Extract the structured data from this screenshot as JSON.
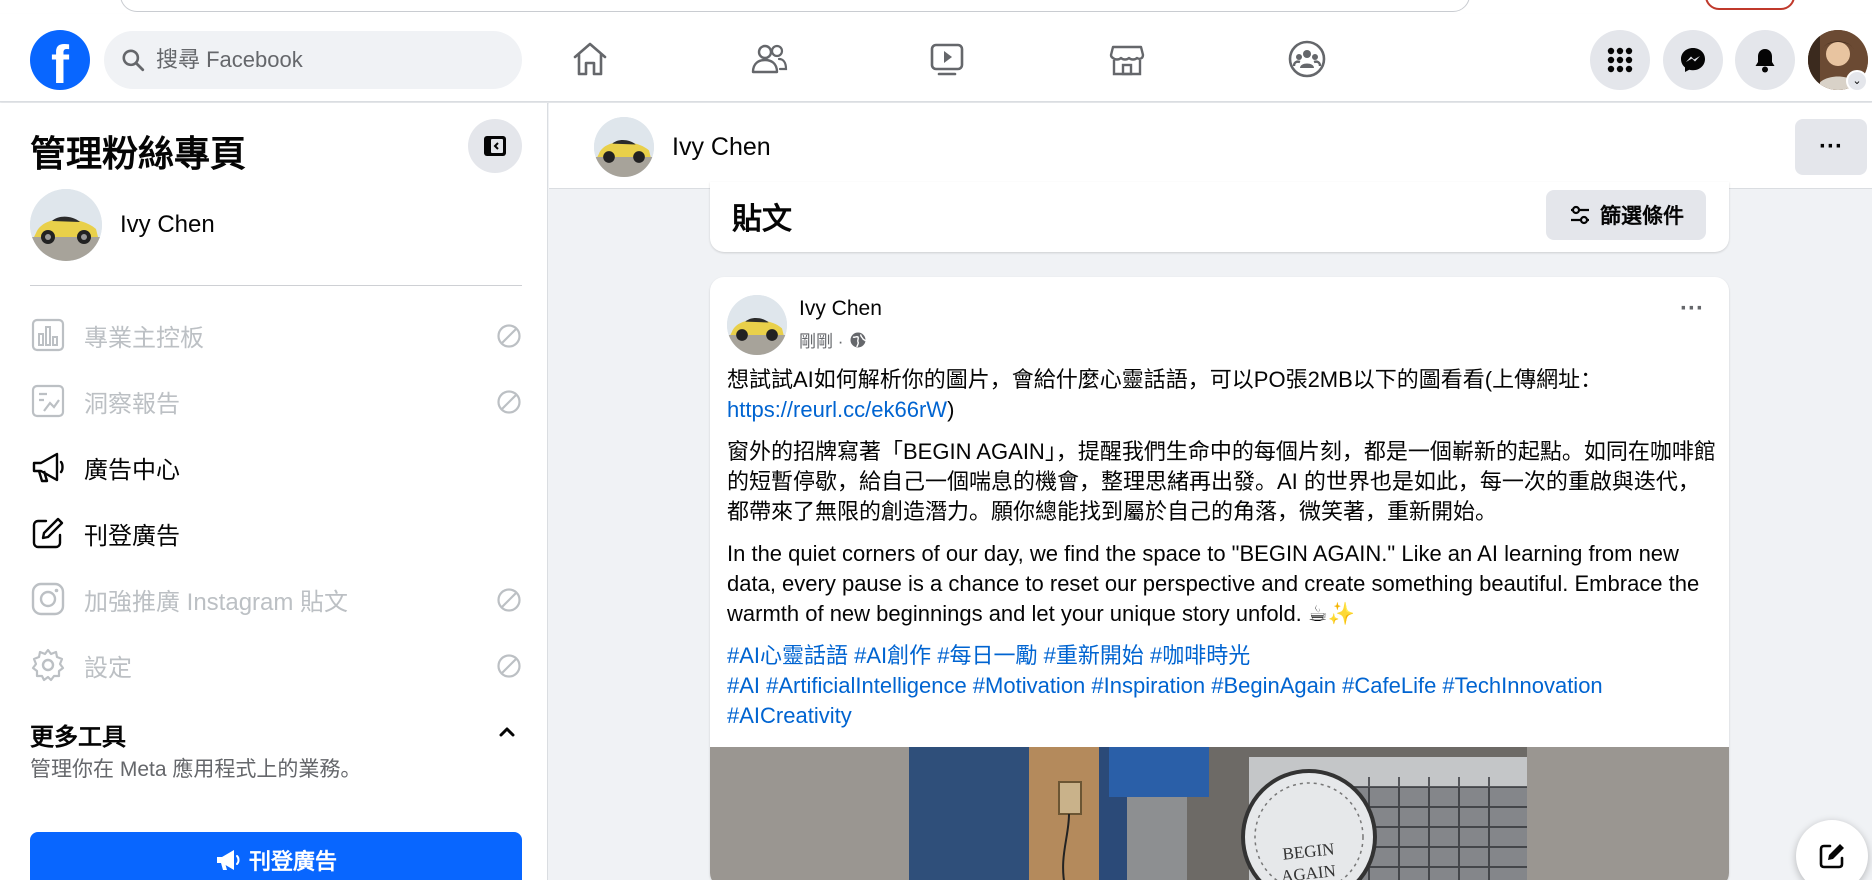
{
  "search": {
    "placeholder": "搜尋 Facebook"
  },
  "nav": {
    "icons": [
      "home-icon",
      "friends-icon",
      "video-icon",
      "marketplace-icon",
      "groups-icon"
    ],
    "right_icons": [
      "menu-grid-icon",
      "messenger-icon",
      "bell-icon"
    ]
  },
  "sidebar": {
    "title": "管理粉絲專頁",
    "page_name": "Ivy Chen",
    "items": [
      {
        "label": "專業主控板",
        "icon": "dashboard-icon",
        "enabled": false
      },
      {
        "label": "洞察報告",
        "icon": "insights-icon",
        "enabled": false
      },
      {
        "label": "廣告中心",
        "icon": "megaphone-icon",
        "enabled": true
      },
      {
        "label": "刊登廣告",
        "icon": "edit-icon",
        "enabled": true
      },
      {
        "label": "加強推廣 Instagram 貼文",
        "icon": "instagram-icon",
        "enabled": false
      },
      {
        "label": "設定",
        "icon": "gear-icon",
        "enabled": false
      }
    ],
    "more_tools_title": "更多工具",
    "more_tools_subtitle": "管理你在 Meta 應用程式上的業務。",
    "cta_label": "刊登廣告"
  },
  "page_header": {
    "name": "Ivy Chen",
    "more_label": "···"
  },
  "posts": {
    "title": "貼文",
    "filter_label": "篩選條件"
  },
  "post": {
    "author": "Ivy Chen",
    "time": "剛剛 ·",
    "more_label": "···",
    "p1_text": "想試試AI如何解析你的圖片，會給什麼心靈話語，可以PO張2MB以下的圖看看(上傳網址：",
    "p1_link": "https://reurl.cc/ek66rW",
    "p1_close": ")",
    "p2": "窗外的招牌寫著「BEGIN AGAIN」，提醒我們生命中的每個片刻，都是一個嶄新的起點。如同在咖啡館的短暫停歇，給自己一個喘息的機會，整理思緒再出發。AI 的世界也是如此，每一次的重啟與迭代，都帶來了無限的創造潛力。願你總能找到屬於自己的角落，微笑著，重新開始。",
    "p3": "In the quiet corners of our day, we find the space to \"BEGIN AGAIN.\" Like an AI learning from new data, every pause is a chance to reset our perspective and create something beautiful. Embrace the warmth of new beginnings and let your unique story unfold. ☕✨",
    "hashtags_zh": "#AI心靈話語 #AI創作 #每日一勵 #重新開始 #咖啡時光",
    "hashtags_en": "#AI #ArtificialIntelligence #Motivation #Inspiration #BeginAgain #CafeLife #TechInnovation #AICreativity",
    "image_sign_text": "BEGIN AGAIN"
  },
  "colors": {
    "brand": "#0866ff",
    "link": "#0064d1",
    "disabled": "#bcc0c4",
    "muted": "#65676b"
  }
}
